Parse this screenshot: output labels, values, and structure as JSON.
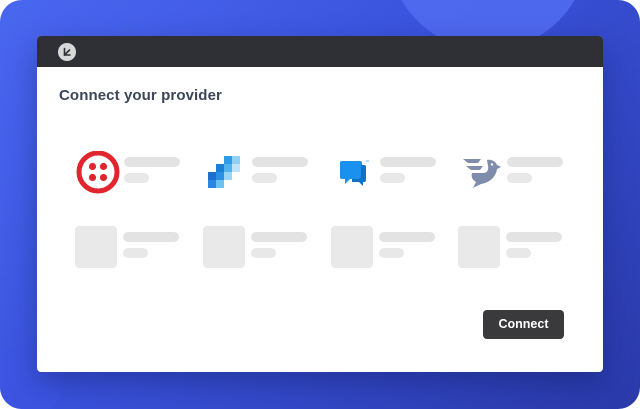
{
  "page": {
    "title": "Connect your provider",
    "connect_label": "Connect"
  },
  "providers": [
    {
      "name": "twilio-logo-icon"
    },
    {
      "name": "blue-squares-logo-icon"
    },
    {
      "name": "chat-bubbles-tm-logo-icon",
      "mark": "™"
    },
    {
      "name": "bird-logo-icon"
    }
  ],
  "colors": {
    "background": "#3f5be8",
    "titlebar": "#2f3035",
    "title_text": "#3b4658",
    "button": "#3a3a3d",
    "twilio_red": "#e1252f",
    "brand_blue": "#1e8fe0",
    "chat_blue": "#1a90ef",
    "bird_gray": "#7f8cab"
  }
}
